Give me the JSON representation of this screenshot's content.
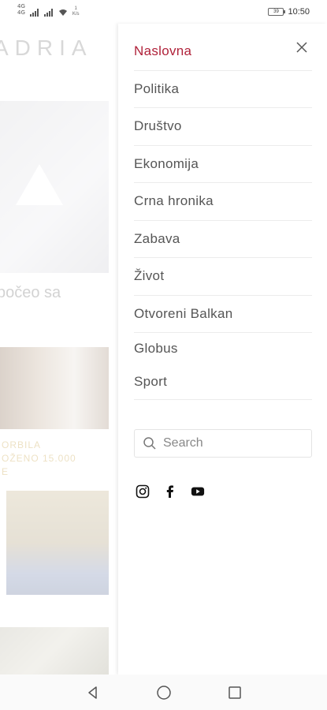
{
  "status": {
    "sim1": "4G",
    "sim2": "4G",
    "net_speed": "1\nK/s",
    "battery": "39",
    "time": "10:50"
  },
  "background": {
    "logo": "ADRIA",
    "headline": "počeo sa",
    "caption_line1": "ORBILA",
    "caption_line2": "OŽENO 15.000",
    "caption_line3": "E"
  },
  "drawer": {
    "nav_items": [
      {
        "label": "Naslovna",
        "active": true
      },
      {
        "label": "Politika"
      },
      {
        "label": "Društvo"
      },
      {
        "label": "Ekonomija"
      },
      {
        "label": "Crna hronika"
      },
      {
        "label": "Zabava"
      },
      {
        "label": "Život"
      },
      {
        "label": "Otvoreni Balkan"
      },
      {
        "label": "Globus"
      },
      {
        "label": "Sport"
      }
    ],
    "search": {
      "placeholder": "Search"
    },
    "socials": [
      "instagram-icon",
      "facebook-icon",
      "youtube-icon"
    ]
  },
  "colors": {
    "accent": "#b0223a",
    "text": "#555555"
  }
}
